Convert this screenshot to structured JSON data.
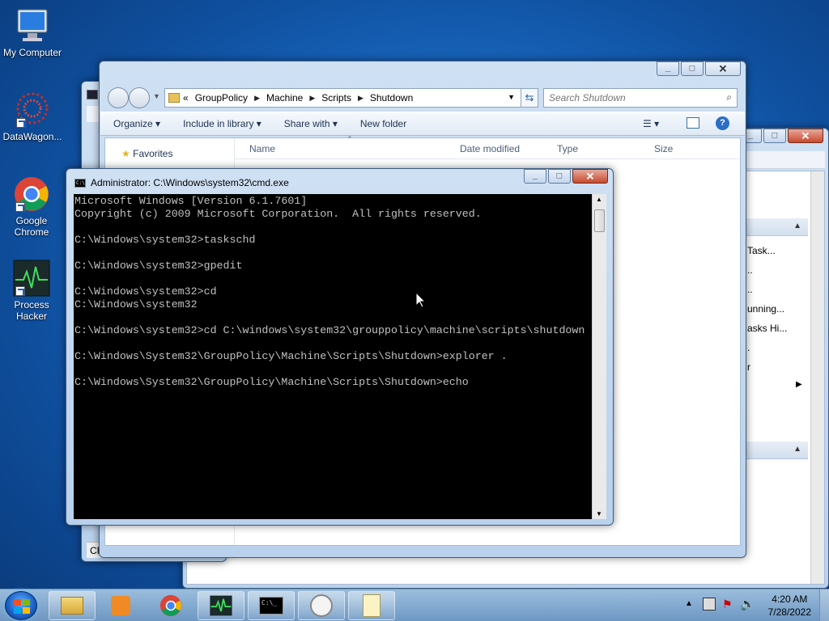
{
  "desktop": {
    "icons": [
      {
        "label": "My Computer",
        "icon": "computer-icon"
      },
      {
        "label": "DataWagon...",
        "icon": "datawagon-icon"
      },
      {
        "label": "Google Chrome",
        "icon": "chrome-icon"
      },
      {
        "label": "Process Hacker",
        "icon": "process-hacker-icon"
      }
    ]
  },
  "explorer": {
    "breadcrumb": [
      "GroupPolicy",
      "Machine",
      "Scripts",
      "Shutdown"
    ],
    "search_placeholder": "Search Shutdown",
    "toolbar": {
      "organize": "Organize",
      "include_in_library": "Include in library",
      "share_with": "Share with",
      "new_folder": "New folder"
    },
    "favorites": "Favorites",
    "columns": [
      "Name",
      "Date modified",
      "Type",
      "Size"
    ]
  },
  "taskmgr": {
    "status": "CPU usa"
  },
  "back_window": {
    "items": [
      "Task...",
      "..",
      "..",
      "unning...",
      "asks Hi...",
      ".",
      "r"
    ]
  },
  "cmd": {
    "title": "Administrator: C:\\Windows\\system32\\cmd.exe",
    "output": "Microsoft Windows [Version 6.1.7601]\nCopyright (c) 2009 Microsoft Corporation.  All rights reserved.\n\nC:\\Windows\\system32>taskschd\n\nC:\\Windows\\system32>gpedit\n\nC:\\Windows\\system32>cd\nC:\\Windows\\system32\n\nC:\\Windows\\system32>cd C:\\windows\\system32\\grouppolicy\\machine\\scripts\\shutdown\n\nC:\\Windows\\System32\\GroupPolicy\\Machine\\Scripts\\Shutdown>explorer .\n\nC:\\Windows\\System32\\GroupPolicy\\Machine\\Scripts\\Shutdown>echo"
  },
  "taskbar": {
    "time": "4:20 AM",
    "date": "7/28/2022"
  },
  "colors": {
    "cmd_bg": "#000000",
    "cmd_fg": "#c0c0c0",
    "close_red": "#c74a2e"
  }
}
